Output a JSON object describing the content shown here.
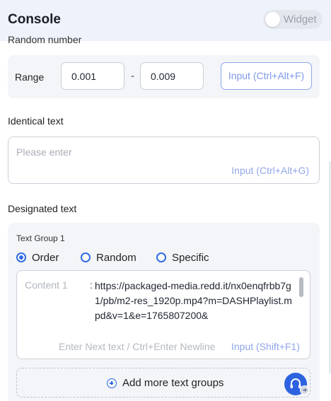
{
  "header": {
    "title": "Console",
    "widget_label": "Widget"
  },
  "random_number": {
    "section_label": "Random number",
    "range_label": "Range",
    "min_value": "0.001",
    "separator": "-",
    "max_value": "0.009",
    "input_button": "Input (Ctrl+Alt+F)"
  },
  "identical_text": {
    "section_label": "Identical text",
    "placeholder": "Please enter",
    "input_shortcut": "Input (Ctrl+Alt+G)"
  },
  "designated_text": {
    "section_label": "Designated text",
    "group_title": "Text Group 1",
    "modes": [
      {
        "label": "Order",
        "selected": true
      },
      {
        "label": "Random",
        "selected": false
      },
      {
        "label": "Specific",
        "selected": false
      }
    ],
    "content_label": "Content 1",
    "content_colon": ":",
    "content_value": "https://packaged-media.redd.it/nx0enqfrbb7g1/pb/m2-res_1920p.mp4?m=DASHPlaylist.mpd&v=1&e=1765807200&",
    "next_hint": "Enter Next text / Ctrl+Enter Newline",
    "input_shortcut": "Input (Shift+F1)",
    "add_group_label": "Add more text groups"
  },
  "colors": {
    "accent": "#2f6be3",
    "header_bg": "#eef2fb",
    "card_bg": "#f4f5f8"
  },
  "icons": {
    "add": "plus-circle-icon",
    "support": "headset-icon",
    "badge": "arrow-right-circle-icon"
  }
}
